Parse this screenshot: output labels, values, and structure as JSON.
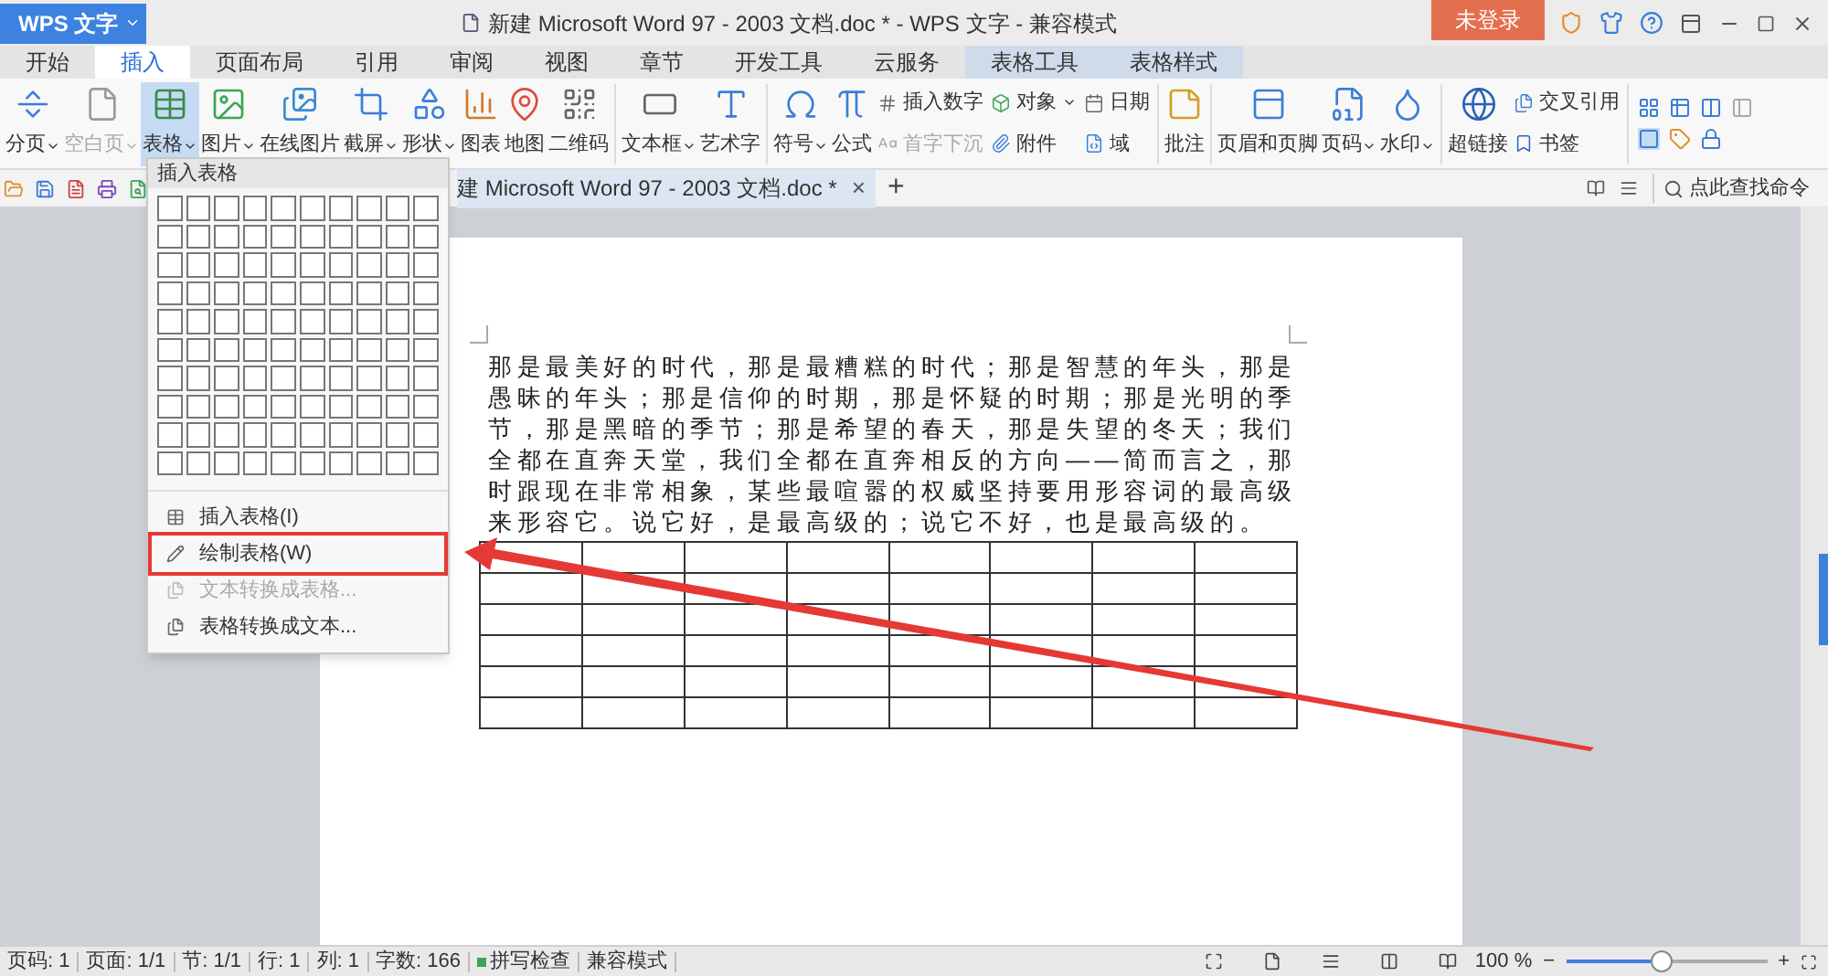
{
  "app_button": {
    "label": "WPS 文字"
  },
  "window": {
    "title": "新建 Microsoft Word 97 - 2003 文档.doc * - WPS 文字 - 兼容模式"
  },
  "login_button": {
    "label": "未登录"
  },
  "tabs": [
    {
      "label": "开始",
      "selected": false,
      "kind": "main"
    },
    {
      "label": "插入",
      "selected": true,
      "kind": "main"
    },
    {
      "label": "页面布局",
      "selected": false,
      "kind": "main"
    },
    {
      "label": "引用",
      "selected": false,
      "kind": "main"
    },
    {
      "label": "审阅",
      "selected": false,
      "kind": "main"
    },
    {
      "label": "视图",
      "selected": false,
      "kind": "main"
    },
    {
      "label": "章节",
      "selected": false,
      "kind": "main"
    },
    {
      "label": "开发工具",
      "selected": false,
      "kind": "main"
    },
    {
      "label": "云服务",
      "selected": false,
      "kind": "main"
    },
    {
      "label": "表格工具",
      "selected": false,
      "kind": "context"
    },
    {
      "label": "表格样式",
      "selected": false,
      "kind": "context"
    }
  ],
  "ribbon": [
    {
      "kind": "large",
      "label": "分页",
      "dropdown": true,
      "disabled": false,
      "open": false
    },
    {
      "kind": "large",
      "label": "空白页",
      "dropdown": true,
      "disabled": true,
      "open": false
    },
    {
      "kind": "large",
      "label": "表格",
      "dropdown": true,
      "disabled": false,
      "open": true
    },
    {
      "kind": "large",
      "label": "图片",
      "dropdown": true,
      "disabled": false,
      "open": false
    },
    {
      "kind": "large",
      "label": "在线图片",
      "dropdown": false,
      "disabled": false,
      "open": false
    },
    {
      "kind": "large",
      "label": "截屏",
      "dropdown": true,
      "disabled": false,
      "open": false
    },
    {
      "kind": "large",
      "label": "形状",
      "dropdown": true,
      "disabled": false,
      "open": false
    },
    {
      "kind": "large",
      "label": "图表",
      "dropdown": false,
      "disabled": false,
      "open": false
    },
    {
      "kind": "large",
      "label": "地图",
      "dropdown": false,
      "disabled": false,
      "open": false
    },
    {
      "kind": "large",
      "label": "二维码",
      "dropdown": false,
      "disabled": false,
      "open": false
    },
    {
      "kind": "separator"
    },
    {
      "kind": "large",
      "label": "文本框",
      "dropdown": true,
      "disabled": false,
      "open": false
    },
    {
      "kind": "large",
      "label": "艺术字",
      "dropdown": false,
      "disabled": false,
      "open": false
    },
    {
      "kind": "separator"
    },
    {
      "kind": "large",
      "label": "符号",
      "dropdown": true,
      "disabled": false,
      "open": false
    },
    {
      "kind": "large",
      "label": "公式",
      "dropdown": false,
      "disabled": false,
      "open": false
    },
    {
      "kind": "stack",
      "items": [
        {
          "label": "插入数字",
          "dropdown": false,
          "disabled": false
        },
        {
          "label": "首字下沉",
          "dropdown": false,
          "disabled": true
        }
      ]
    },
    {
      "kind": "stack",
      "items": [
        {
          "label": "对象",
          "dropdown": true,
          "disabled": false
        },
        {
          "label": "附件",
          "dropdown": false,
          "disabled": false
        }
      ]
    },
    {
      "kind": "stack",
      "items": [
        {
          "label": "日期",
          "dropdown": false,
          "disabled": false
        },
        {
          "label": "域",
          "dropdown": false,
          "disabled": false
        }
      ]
    },
    {
      "kind": "separator"
    },
    {
      "kind": "large",
      "label": "批注",
      "dropdown": false,
      "disabled": false,
      "open": false
    },
    {
      "kind": "separator"
    },
    {
      "kind": "large",
      "label": "页眉和页脚",
      "dropdown": false,
      "disabled": false,
      "open": false
    },
    {
      "kind": "large",
      "label": "页码",
      "dropdown": true,
      "disabled": false,
      "open": false
    },
    {
      "kind": "large",
      "label": "水印",
      "dropdown": true,
      "disabled": false,
      "open": false
    },
    {
      "kind": "separator"
    },
    {
      "kind": "large",
      "label": "超链接",
      "dropdown": false,
      "disabled": false,
      "open": false
    },
    {
      "kind": "stack",
      "items": [
        {
          "label": "交叉引用",
          "dropdown": false,
          "disabled": false
        },
        {
          "label": "书签",
          "dropdown": false,
          "disabled": false
        }
      ]
    },
    {
      "kind": "separator"
    },
    {
      "kind": "icon_grid"
    }
  ],
  "document_tab": {
    "title": "建 Microsoft Word 97 - 2003 文档.doc *",
    "close": "×",
    "new_tab": "+"
  },
  "command_search": {
    "placeholder": "点此查找命令"
  },
  "table_menu": {
    "title": "插入表格",
    "items": [
      {
        "label": "插入表格(I)",
        "disabled": false,
        "annotated": false
      },
      {
        "label": "绘制表格(W)",
        "disabled": false,
        "annotated": true
      },
      {
        "label": "文本转换成表格...",
        "disabled": true,
        "annotated": false
      },
      {
        "label": "表格转换成文本...",
        "disabled": false,
        "annotated": false
      }
    ]
  },
  "document": {
    "paragraph": "那是最美好的时代，那是最糟糕的时代；那是智慧的年头，那是愚昧的年头；那是信仰的时期，那是怀疑的时期；那是光明的季节，那是黑暗的季节；那是希望的春天，那是失望的冬天；我们全都在直奔天堂，我们全都在直奔相反的方向——简而言之，那时跟现在非常相象，某些最喧嚣的权威坚持要用形容词的最高级来形容它。说它好，是最高级的；说它不好，也是最高级的。"
  },
  "status_bar": {
    "items": [
      {
        "label": "页码: 1",
        "kind": "text"
      },
      {
        "label": "页面: 1/1",
        "kind": "text"
      },
      {
        "label": "节: 1/1",
        "kind": "text"
      },
      {
        "label": "行: 1",
        "kind": "text"
      },
      {
        "label": "列: 1",
        "kind": "text"
      },
      {
        "label": "字数: 166",
        "kind": "text"
      },
      {
        "label": "拼写检查",
        "kind": "spell"
      },
      {
        "label": "兼容模式",
        "kind": "text"
      }
    ],
    "zoom": "100 %",
    "zoom_out": "−",
    "zoom_in": "+",
    "zoom_slider": {
      "level": 0.48
    }
  }
}
